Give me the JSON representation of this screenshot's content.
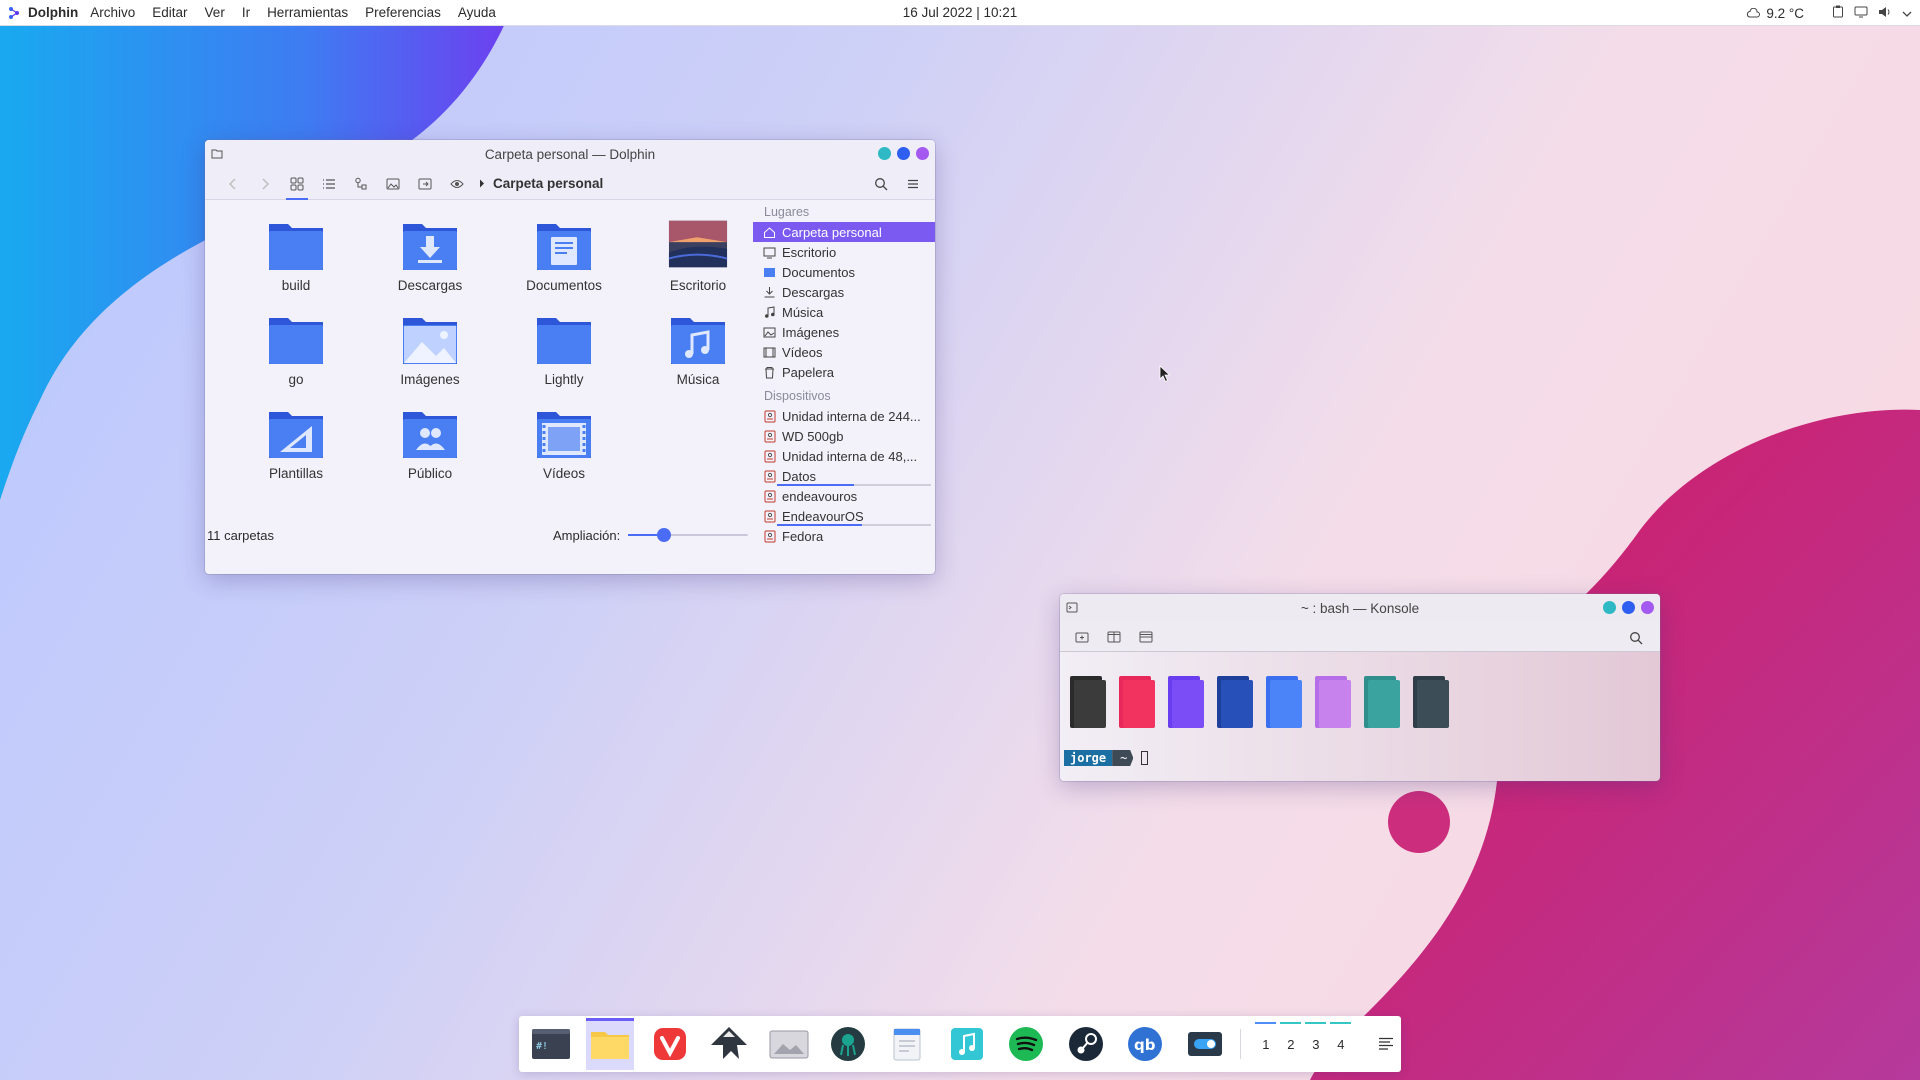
{
  "topbar": {
    "app_name": "Dolphin",
    "menus": [
      "Archivo",
      "Editar",
      "Ver",
      "Ir",
      "Herramientas",
      "Preferencias",
      "Ayuda"
    ],
    "clock": "16 Jul 2022 | 10:21",
    "weather": "9.2 °C"
  },
  "dolphin": {
    "title": "Carpeta personal — Dolphin",
    "breadcrumb": "Carpeta personal",
    "items": [
      {
        "label": "build",
        "icon": "folder"
      },
      {
        "label": "Descargas",
        "icon": "folder-download"
      },
      {
        "label": "Documentos",
        "icon": "folder-documents"
      },
      {
        "label": "Escritorio",
        "icon": "desktop-thumbnail"
      },
      {
        "label": "go",
        "icon": "folder"
      },
      {
        "label": "Imágenes",
        "icon": "folder-pictures"
      },
      {
        "label": "Lightly",
        "icon": "folder"
      },
      {
        "label": "Música",
        "icon": "folder-music"
      },
      {
        "label": "Plantillas",
        "icon": "folder-templates"
      },
      {
        "label": "Público",
        "icon": "folder-public"
      },
      {
        "label": "Vídeos",
        "icon": "folder-videos"
      }
    ],
    "status": "11 carpetas",
    "zoom_label": "Ampliación:",
    "zoom_level": 0.3,
    "places_header": "Lugares",
    "places": [
      {
        "label": "Carpeta personal",
        "icon": "home-icon",
        "selected": true
      },
      {
        "label": "Escritorio",
        "icon": "desktop-icon"
      },
      {
        "label": "Documentos",
        "icon": "documents-icon"
      },
      {
        "label": "Descargas",
        "icon": "download-icon"
      },
      {
        "label": "Música",
        "icon": "music-icon"
      },
      {
        "label": "Imágenes",
        "icon": "image-icon"
      },
      {
        "label": "Vídeos",
        "icon": "video-icon"
      },
      {
        "label": "Papelera",
        "icon": "trash-icon"
      }
    ],
    "devices_header": "Dispositivos",
    "devices": [
      {
        "label": "Unidad interna de 244...",
        "usage": null
      },
      {
        "label": "WD 500gb",
        "usage": null
      },
      {
        "label": "Unidad interna de 48,...",
        "usage": null
      },
      {
        "label": "Datos",
        "usage": 0.5
      },
      {
        "label": "endeavouros",
        "usage": null
      },
      {
        "label": "EndeavourOS",
        "usage": 0.55
      },
      {
        "label": "Fedora",
        "usage": null
      }
    ]
  },
  "konsole": {
    "title": "~ : bash — Konsole",
    "swatches": [
      {
        "back": "#2b2b2b",
        "front": "#3b3b3b"
      },
      {
        "back": "#e8285a",
        "front": "#f2335f"
      },
      {
        "back": "#6a3df0",
        "front": "#7b4df7"
      },
      {
        "back": "#1e3f9a",
        "front": "#2750b8"
      },
      {
        "back": "#3a6ff0",
        "front": "#4a84f8"
      },
      {
        "back": "#b56ee8",
        "front": "#c882ee"
      },
      {
        "back": "#2f8f8c",
        "front": "#3aa3a0"
      },
      {
        "back": "#2e3d47",
        "front": "#3d4d58"
      }
    ],
    "prompt_user": "jorge",
    "prompt_dir": "~"
  },
  "dock": {
    "apps": [
      "konsole",
      "dolphin",
      "vivaldi",
      "inkscape",
      "image-viewer",
      "gitkraken",
      "text-editor",
      "music-player",
      "spotify",
      "steam",
      "qbittorrent",
      "settings-toggle"
    ],
    "active_app": "dolphin",
    "desktops": [
      "1",
      "2",
      "3",
      "4"
    ]
  },
  "colors": {
    "accent": "#4a6cf7",
    "selection": "#7a5af0"
  }
}
